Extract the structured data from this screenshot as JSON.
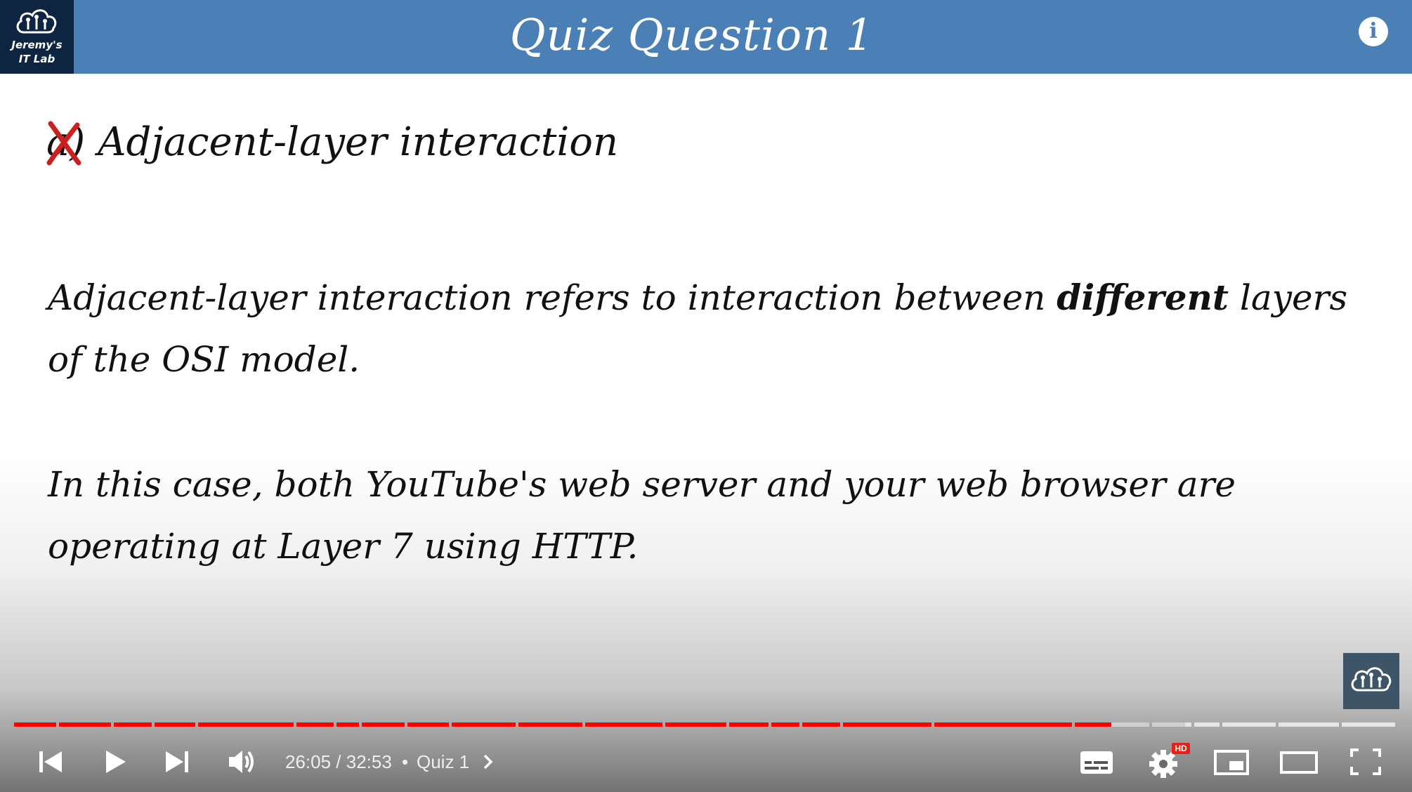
{
  "logo": {
    "line1": "Jeremy's",
    "line2": "IT Lab"
  },
  "slide": {
    "title": "Quiz Question 1",
    "answer_letter": "a",
    "answer_paren": ")",
    "answer_text": "Adjacent-layer interaction",
    "para1_before": "Adjacent-layer interaction refers to interaction between ",
    "para1_bold": "different",
    "para1_after": " layers of the OSI model.",
    "para2": "In this case, both YouTube's web server and your web browser are operating at Layer 7 using HTTP."
  },
  "player": {
    "current_time": "26:05",
    "time_separator": " / ",
    "duration": "32:53",
    "chapter_separator": "•",
    "chapter_title": "Quiz 1",
    "hd_badge": "HD",
    "progress_fraction": 0.793,
    "buffer_fraction": 0.846
  },
  "colors": {
    "header": "#4a80b6",
    "progress_played": "#ff0000",
    "progress_buffered": "#cfcfcf",
    "progress_unplayed": "#e6e6e6",
    "wrong_mark": "#cc1f1f"
  },
  "icons": {
    "logo": "cloud-circuit-icon",
    "info": "info-icon",
    "previous": "skip-previous-icon",
    "play": "play-icon",
    "next": "skip-next-icon",
    "volume": "volume-icon",
    "chapter": "chevron-right-icon",
    "subtitles": "subtitles-icon",
    "settings": "gear-icon",
    "miniplayer": "miniplayer-icon",
    "theater": "theater-mode-icon",
    "fullscreen": "fullscreen-icon"
  }
}
